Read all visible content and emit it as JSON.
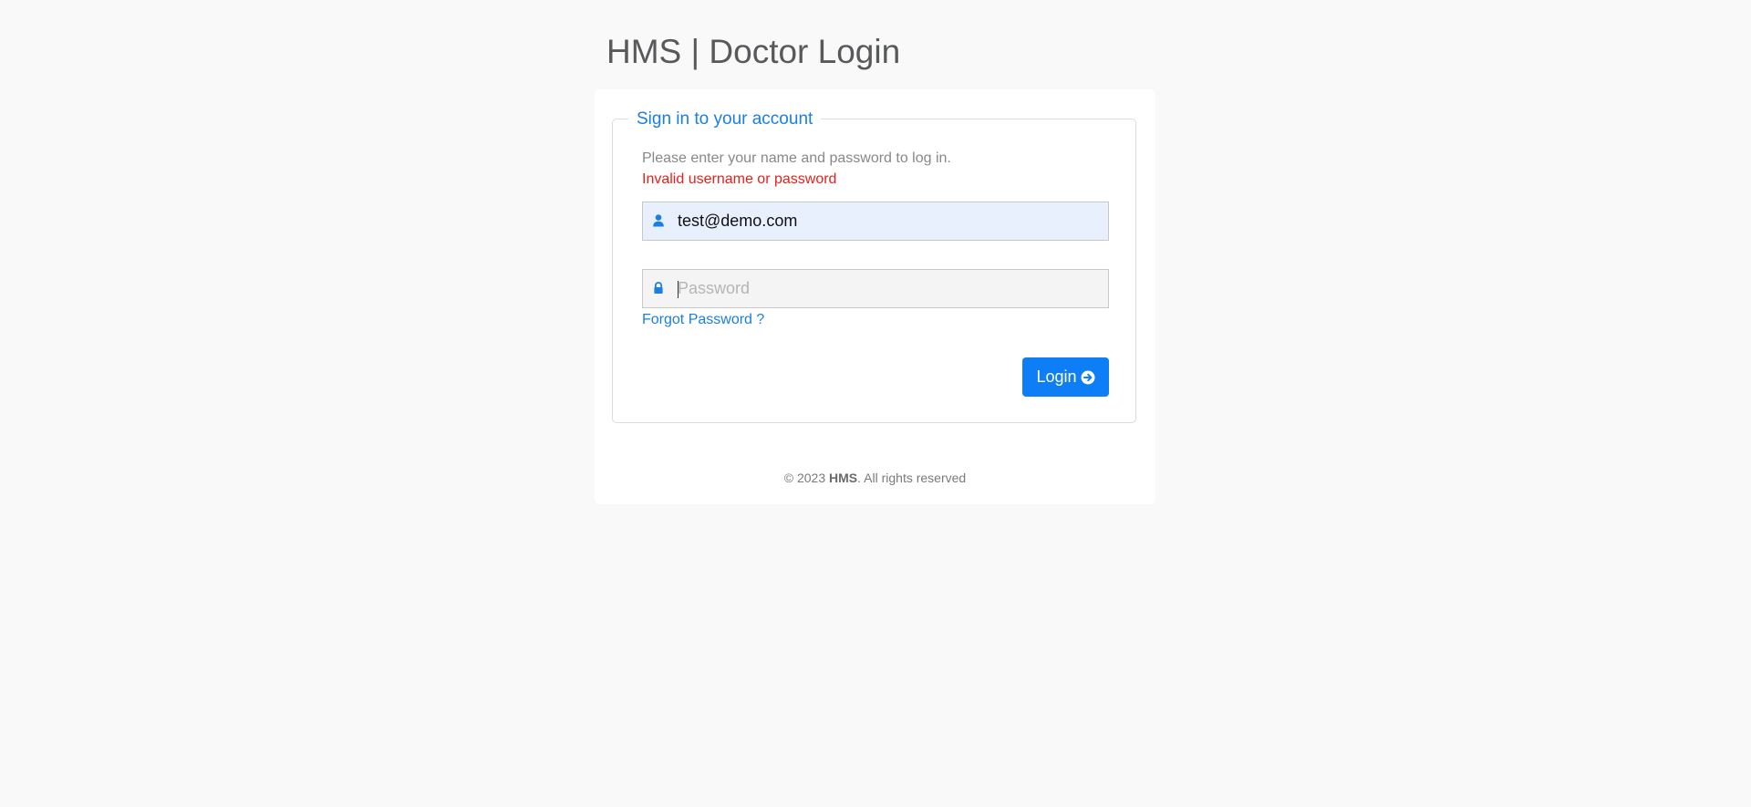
{
  "header": {
    "title": "HMS | Doctor Login"
  },
  "login_form": {
    "legend": "Sign in to your account",
    "hint": "Please enter your name and password to log in.",
    "error": "Invalid username or password",
    "username": {
      "value": "test@demo.com",
      "icon": "user-icon"
    },
    "password": {
      "value": "",
      "placeholder": "Password",
      "icon": "lock-icon"
    },
    "forgot_password": "Forgot Password ?",
    "login_button": {
      "label": "Login",
      "icon": "arrow-circle-right-icon"
    }
  },
  "footer": {
    "prefix": "© 2023 ",
    "brand": "HMS",
    "suffix": ". All rights reserved"
  },
  "colors": {
    "accent": "#0d7ef5",
    "link": "#1a7fe0",
    "error": "#e8201b",
    "autofill_background": "#e8f0fe",
    "page_background": "#f9f9f9"
  }
}
